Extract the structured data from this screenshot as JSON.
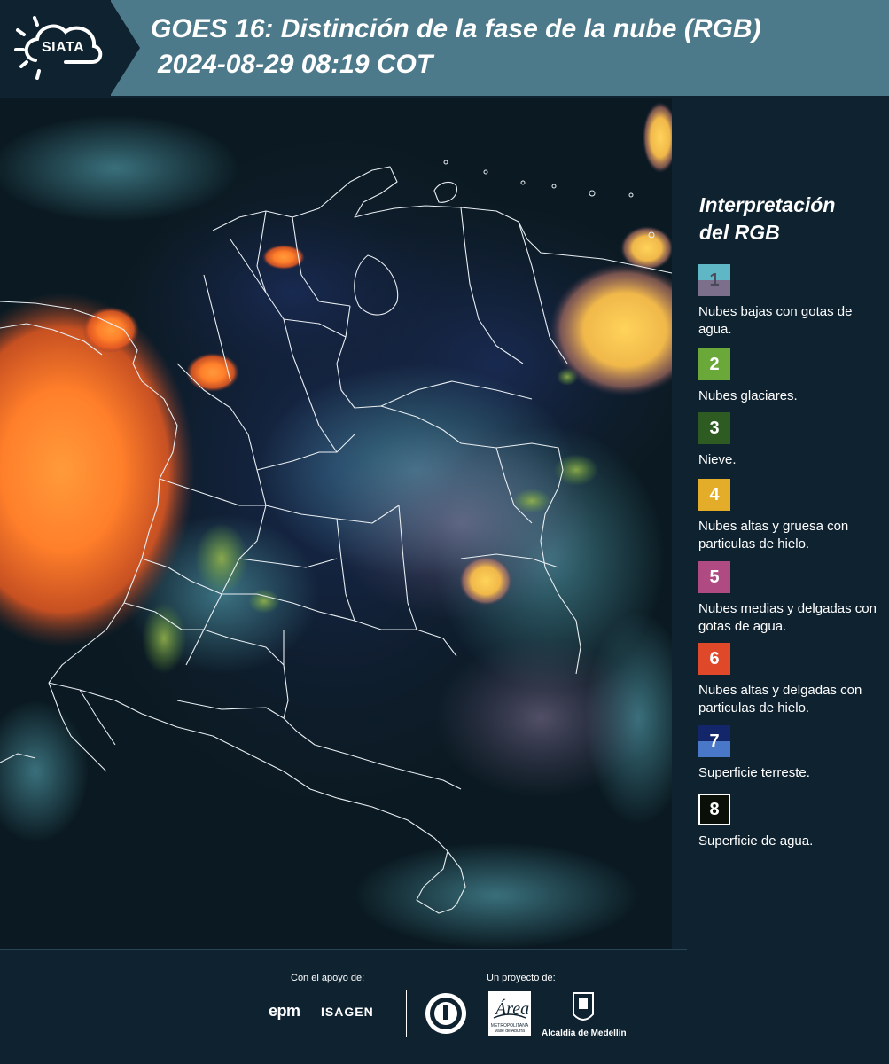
{
  "header": {
    "logo_text": "SIATA",
    "title": "GOES 16: Distinción de la fase de la nube (RGB)",
    "datetime": "2024-08-29 08:19 COT"
  },
  "legend": {
    "title_line1": "Interpretación",
    "title_line2": "del RGB",
    "items": [
      {
        "number": "1",
        "label": "Nubes bajas con gotas de agua.",
        "color_top": "#5fb6c4",
        "color_bottom": "#7c6f8c",
        "num_color": "#4a4a5a"
      },
      {
        "number": "2",
        "label": "Nubes glaciares.",
        "color_top": "#6aa83a",
        "color_bottom": "#6aa83a",
        "num_color": "#ffffff"
      },
      {
        "number": "3",
        "label": "Nieve.",
        "color_top": "#2e5b22",
        "color_bottom": "#2e5b22",
        "num_color": "#ffffff"
      },
      {
        "number": "4",
        "label": "Nubes altas y gruesa con particulas de hielo.",
        "color_top": "#e3ad2a",
        "color_bottom": "#e3ad2a",
        "num_color": "#ffffff"
      },
      {
        "number": "5",
        "label": "Nubes medias y delgadas con gotas de agua.",
        "color_top": "#b04a83",
        "color_bottom": "#b04a83",
        "num_color": "#ffffff"
      },
      {
        "number": "6",
        "label": "Nubes altas y delgadas con particulas de hielo.",
        "color_top": "#e0482a",
        "color_bottom": "#e0482a",
        "num_color": "#ffffff"
      },
      {
        "number": "7",
        "label": "Superficie terreste.",
        "color_top": "#13266a",
        "color_bottom": "#4a78c8",
        "num_color": "#ffffff"
      },
      {
        "number": "8",
        "label": "Superficie de agua.",
        "color_top": "#0a0f08",
        "color_bottom": "#0a0f08",
        "num_color": "#ffffff"
      }
    ]
  },
  "footer": {
    "support_label": "Con el apoyo de:",
    "project_label": "Un proyecto de:",
    "sponsor1": "epm",
    "sponsor2": "ISAGEN",
    "partner_area": "Área",
    "partner_area_sub": "METROPOLITANA Valle de Aburrá",
    "partner_medellin": "Alcaldía de Medellín"
  }
}
